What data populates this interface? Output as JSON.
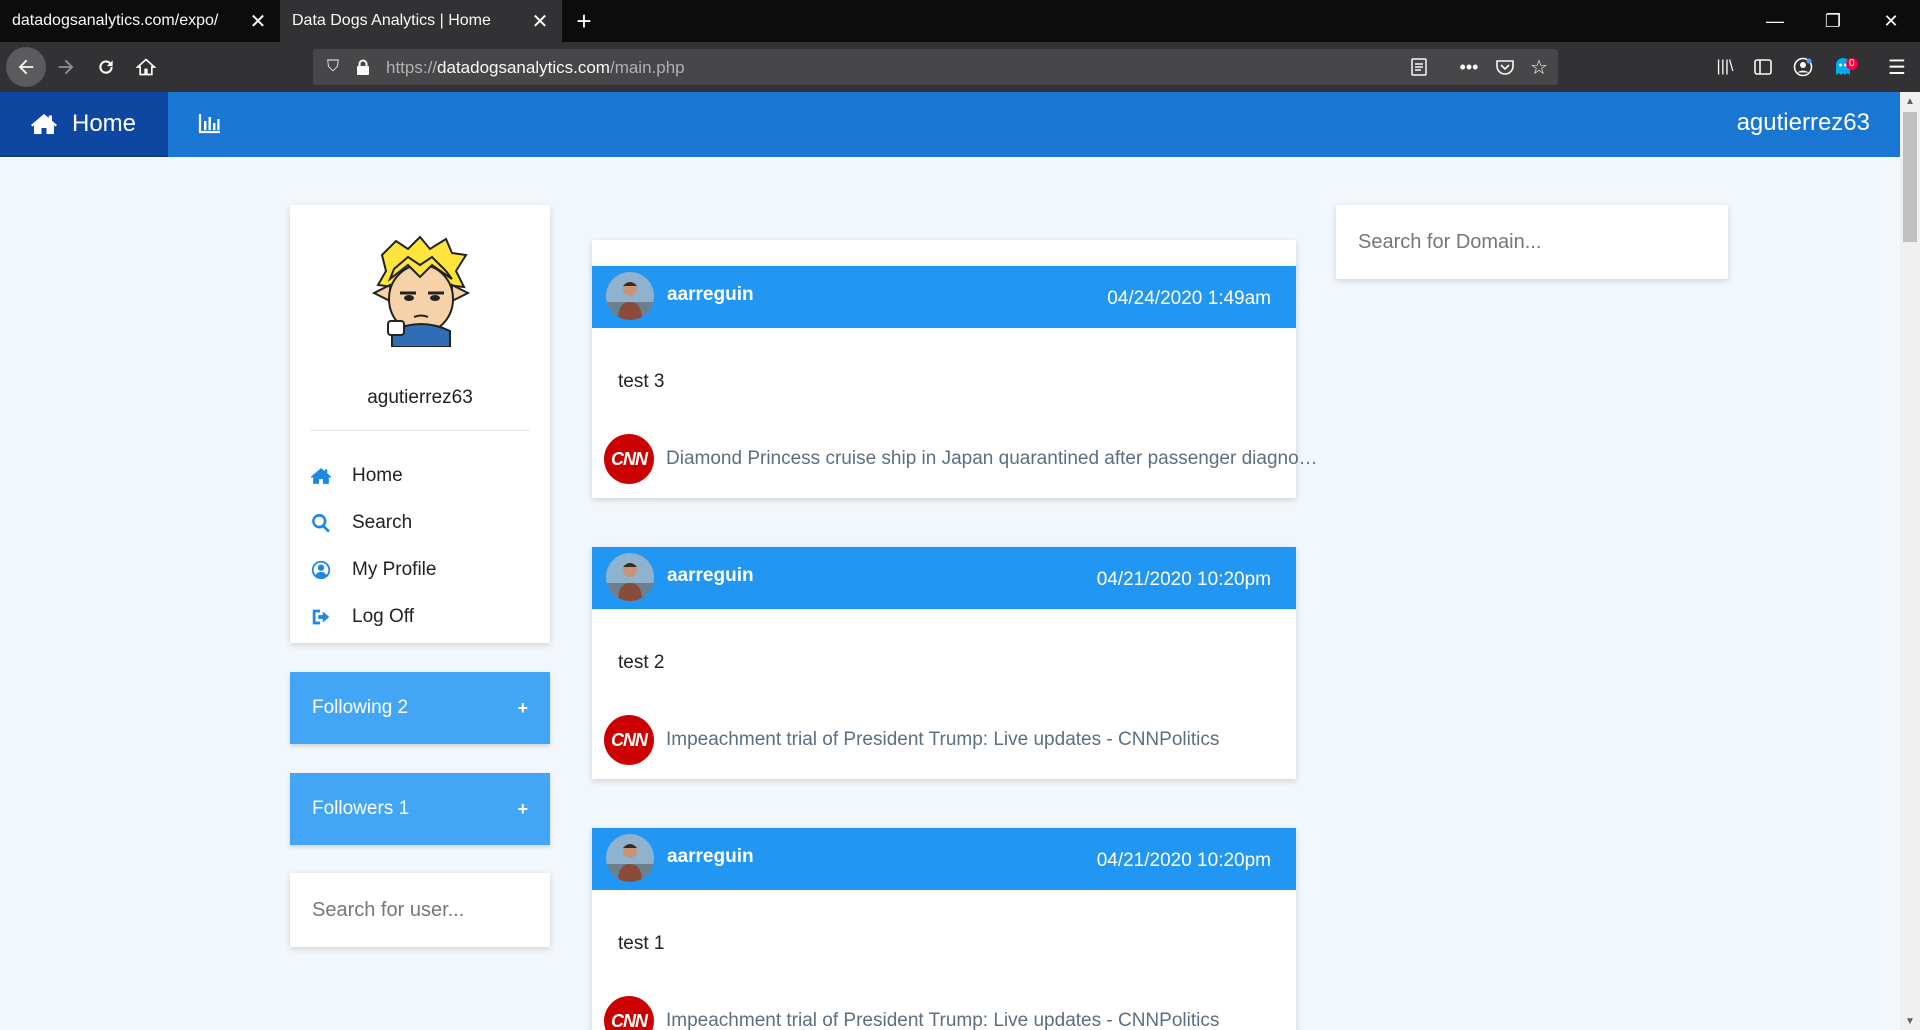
{
  "browser": {
    "tabs": [
      {
        "title": "datadogsanalytics.com/expo/",
        "active": false
      },
      {
        "title": "Data Dogs Analytics | Home",
        "active": true
      }
    ],
    "url_prefix": "https://",
    "url_host": "datadogsanalytics.com",
    "url_path": "/main.php",
    "extension_badge": "0"
  },
  "appbar": {
    "home_label": "Home",
    "username": "agutierrez63"
  },
  "profile": {
    "username": "agutierrez63",
    "menu": [
      {
        "label": "Home",
        "icon": "home-icon"
      },
      {
        "label": "Search",
        "icon": "search-icon"
      },
      {
        "label": "My Profile",
        "icon": "user-circle-icon"
      },
      {
        "label": "Log Off",
        "icon": "sign-out-icon"
      }
    ]
  },
  "following": {
    "label": "Following 2",
    "expand": "+"
  },
  "followers": {
    "label": "Followers 1",
    "expand": "+"
  },
  "search_user": {
    "placeholder": "Search for user..."
  },
  "search_domain": {
    "placeholder": "Search for Domain..."
  },
  "posts": [
    {
      "user": "aarreguin",
      "date": "04/24/2020  1:49am",
      "text": "test 3",
      "source_icon": "cnn-logo",
      "link": "Diamond Princess cruise ship in Japan quarantined after passenger diagnosed with coronavirus"
    },
    {
      "user": "aarreguin",
      "date": "04/21/2020  10:20pm",
      "text": "test 2",
      "source_icon": "cnn-logo",
      "link": "Impeachment trial of President Trump: Live updates - CNNPolitics"
    },
    {
      "user": "aarreguin",
      "date": "04/21/2020  10:20pm",
      "text": "test 1",
      "source_icon": "cnn-logo",
      "link": "Impeachment trial of President Trump: Live updates - CNNPolitics"
    }
  ],
  "colors": {
    "appbar": "#1976d2",
    "home_tab": "#0d47a1",
    "post_header": "#2196f3",
    "follow_box": "#42a5f5",
    "cnn_red": "#cc0000"
  }
}
